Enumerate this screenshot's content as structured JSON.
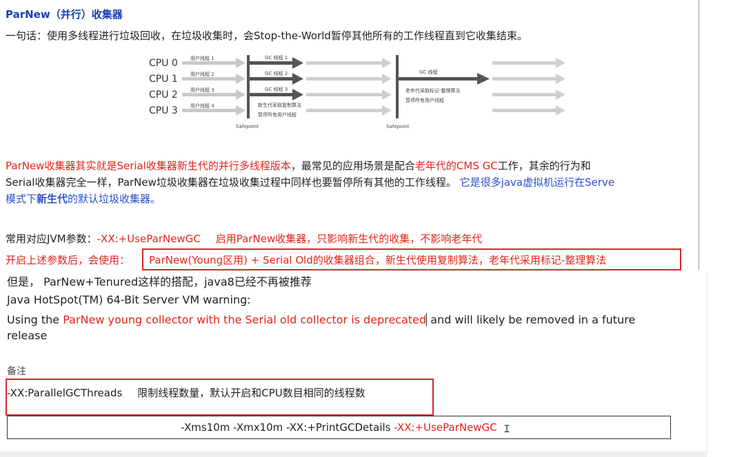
{
  "title": "ParNew（并行）收集器",
  "summary": "一句话：使用多线程进行垃圾回收，在垃圾收集时，会Stop-the-World暂停其他所有的工作线程直到它收集结束。",
  "diagram": {
    "cpus": [
      "CPU 0",
      "CPU 1",
      "CPU 2",
      "CPU 3"
    ],
    "user_threads": [
      "用户线程 1",
      "用户线程 2",
      "用户线程 3",
      "用户线程 4"
    ],
    "gc_threads": [
      "GC 线程 1",
      "GC 线程 2",
      "GC 线程 3"
    ],
    "gc_thread_single": "GC 线程",
    "young_note_1": "新生代采取复制算法",
    "young_note_2": "暂停所有用户线程",
    "old_note_1": "老年代采取标记-整理算法",
    "old_note_2": "暂停所有用户线程",
    "safepoint_1": "Safepoint",
    "safepoint_2": "Safepoint"
  },
  "para1": {
    "l1_a": "ParNew收集器其实就是Serial收集器新生代的并行多线程版本",
    "l1_b": "，最常见的应用场景是配合",
    "l1_c": "老年代的CMS GC",
    "l1_d": "工作，其余的行为和",
    "l2_a": "Serial收集器完全一样，ParNew垃圾收集器在垃圾收集过程中同样也要暂停所有其他的工作线程。",
    "l2_b": "它是很多java虚拟机运行在Serve",
    "l3_a": "模式下",
    "l3_b": "新生代",
    "l3_c": "的默认垃圾收集器。"
  },
  "jvm": {
    "label": "常用对应JVM参数：",
    "flag": "-XX:+UseParNewGC",
    "desc": "启用ParNew收集器，只影响新生代的收集，不影响老年代",
    "enable_label": "开启上述参数后，会使用：",
    "enable_text": "ParNew(Young区用) + Serial Old的收集器组合，新生代使用复制算法，老年代采用标记-整理算法"
  },
  "note": {
    "line1": "但是， ParNew+Tenured这样的搭配，java8已经不再被推荐",
    "line2": "Java HotSpot(TM) 64-Bit Server VM warning:",
    "line3_a": "Using the ",
    "line3_b": "ParNew young collector with the Serial old collector is deprecated",
    "line3_c": " and will likely be removed in a future",
    "line4": "release"
  },
  "remark": {
    "label": "备注",
    "flag": "-XX:ParallelGCThreads",
    "desc": "限制线程数量，默认开启和CPU数目相同的线程数"
  },
  "command": {
    "prefix": "-Xms10m -Xmx10m -XX:+PrintGCDetails ",
    "flag": "-XX:+UseParNewGC"
  }
}
